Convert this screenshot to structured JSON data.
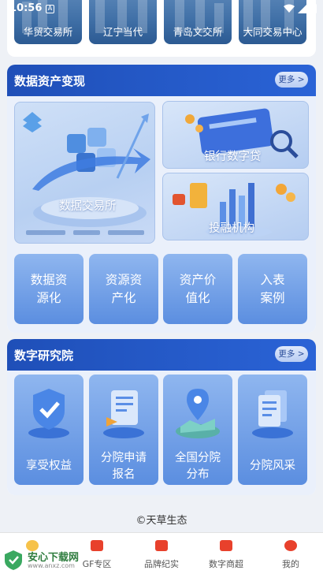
{
  "status_bar": {
    "time": "10:56",
    "notification_letter": "A"
  },
  "exchanges": [
    {
      "label": "华贸交易所"
    },
    {
      "label": "辽宁当代"
    },
    {
      "label": "青岛文交所"
    },
    {
      "label": "大同交易中心"
    }
  ],
  "asset_section": {
    "title": "数据资产变现",
    "more_label": "更多 >",
    "data_exchange_label": "数据交易所",
    "bank_loan_label": "银行数字贷",
    "investment_label": "投融机构",
    "tiles": [
      {
        "line1": "数据资",
        "line2": "源化"
      },
      {
        "line1": "资源资",
        "line2": "产化"
      },
      {
        "line1": "资产价",
        "line2": "值化"
      },
      {
        "line1": "入表",
        "line2": "案例"
      }
    ]
  },
  "research_section": {
    "title": "数字研究院",
    "more_label": "更多 >",
    "tiles": [
      {
        "line1": "享受权益",
        "line2": ""
      },
      {
        "line1": "分院申请",
        "line2": "报名"
      },
      {
        "line1": "全国分院",
        "line2": "分布"
      },
      {
        "line1": "分院风采",
        "line2": ""
      }
    ]
  },
  "footer": {
    "text": "©天草生态"
  },
  "bottom_nav": [
    {
      "label": "",
      "icon": "home-icon",
      "color": "#e8412c"
    },
    {
      "label": "GF专区",
      "icon": "gf-zone-icon",
      "color": "#e8412c"
    },
    {
      "label": "品牌纪实",
      "icon": "brand-record-icon",
      "color": "#e8412c"
    },
    {
      "label": "数字商超",
      "icon": "digital-store-icon",
      "color": "#e8412c"
    },
    {
      "label": "我的",
      "icon": "lantern-icon",
      "color": "#e8412c"
    }
  ],
  "watermark": {
    "title": "安心下载网",
    "url": "www.anxz.com"
  },
  "colors": {
    "header_blue": "#2a63d6",
    "tile_blue": "#6a98e4",
    "nav_red": "#e8412c"
  }
}
